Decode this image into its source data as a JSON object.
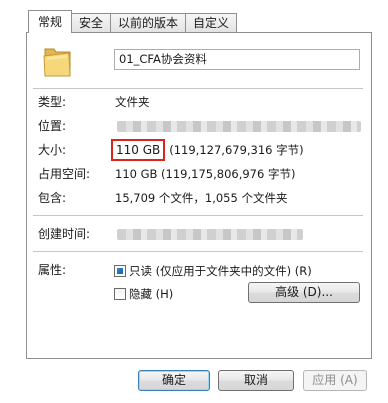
{
  "tabs": [
    {
      "label": "常规",
      "active": true
    },
    {
      "label": "安全",
      "active": false
    },
    {
      "label": "以前的版本",
      "active": false
    },
    {
      "label": "自定义",
      "active": false
    }
  ],
  "folder": {
    "icon": "folder-icon",
    "name": "01_CFA协会资料"
  },
  "properties": {
    "type_label": "类型:",
    "type_value": "文件夹",
    "location_label": "位置:",
    "size_label": "大小:",
    "size_value": "110 GB",
    "size_bytes": "(119,127,679,316 字节)",
    "disk_label": "占用空间:",
    "disk_value": "110 GB (119,175,806,976 字节)",
    "contains_label": "包含:",
    "contains_value": "15,709 个文件，1,055 个文件夹",
    "created_label": "创建时间:"
  },
  "attributes": {
    "label": "属性:",
    "readonly_label": "只读 (仅应用于文件夹中的文件) (R)",
    "hidden_label": "隐藏 (H)",
    "advanced_label": "高级 (D)..."
  },
  "buttons": {
    "ok": "确定",
    "cancel": "取消",
    "apply": "应用 (A)"
  },
  "colors": {
    "highlight_box": "#d9251c"
  }
}
